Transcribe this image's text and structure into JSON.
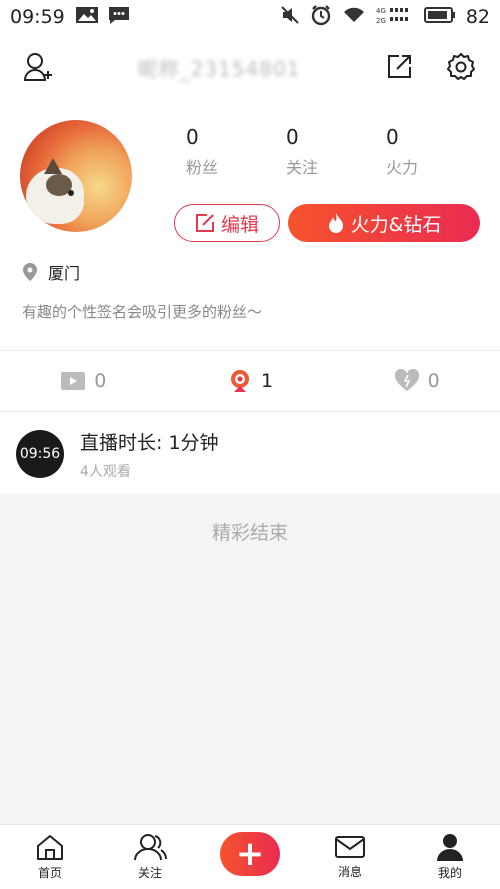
{
  "status_bar": {
    "time": "09:59",
    "battery": "82"
  },
  "header": {
    "username": "昵称_23154801"
  },
  "profile": {
    "stats": [
      {
        "value": "0",
        "label": "粉丝"
      },
      {
        "value": "0",
        "label": "关注"
      },
      {
        "value": "0",
        "label": "火力"
      }
    ],
    "edit_label": "编辑",
    "fire_label": "火力&钻石",
    "location": "厦门",
    "signature": "有趣的个性签名会吸引更多的粉丝～"
  },
  "tabs": [
    {
      "icon": "video-icon",
      "count": "0"
    },
    {
      "icon": "live-camera-icon",
      "count": "1"
    },
    {
      "icon": "heart-icon",
      "count": "0"
    }
  ],
  "live_record": {
    "time_badge": "09:56",
    "title": "直播时长: 1分钟",
    "viewers": "4人观看"
  },
  "end_text": "精彩结束",
  "bottom_nav": {
    "home": "首页",
    "follow": "关注",
    "plus": "+",
    "messages": "消息",
    "mine": "我的"
  },
  "colors": {
    "accent": "#e23a4e",
    "gradient_start": "#f5532c",
    "gradient_end": "#ea2b52"
  }
}
